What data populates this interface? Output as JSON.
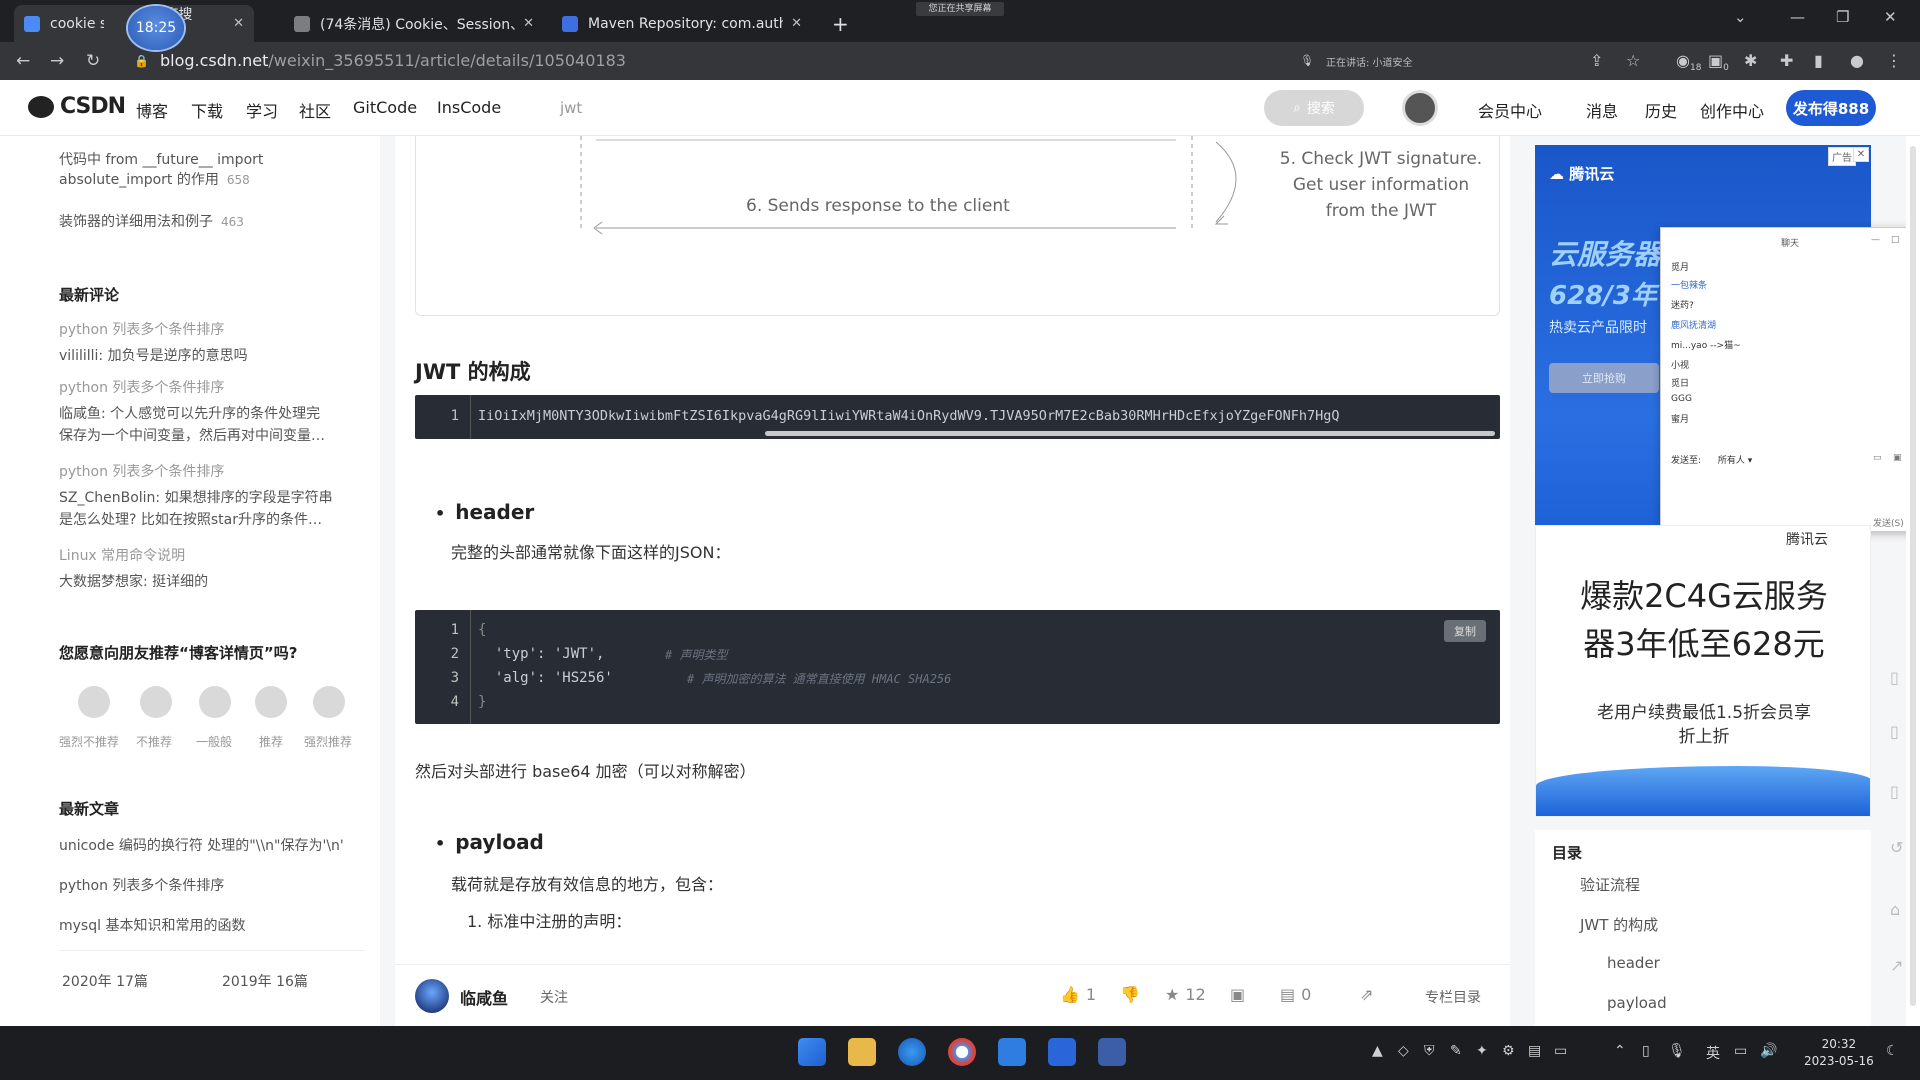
{
  "browser": {
    "tabs": [
      {
        "title": "cookie sessi",
        "fav_color": "#4c8bf5",
        "active": true
      },
      {
        "title": "(74条消息) Cookie、Session、",
        "fav_color": "#7a7d82",
        "active": false
      },
      {
        "title": "Maven Repository: com.auth(",
        "fav_color": "#3d6fe0",
        "active": false
      }
    ],
    "overlap_tab_text": "度搜索",
    "clock_badge": "18:25",
    "share_banner": "您正在共享屏幕",
    "url_host": "blog.csdn.net",
    "url_path": "/weixin_35695511/article/details/105040183",
    "meeting_text": "正在讲话: 小道安全",
    "ext_badges": {
      "profile_count": "18",
      "ext_count": "0"
    }
  },
  "csdn": {
    "logo": "CSDN",
    "nav": [
      "博客",
      "下载",
      "学习",
      "社区",
      "GitCode",
      "InsCode"
    ],
    "search_word": "jwt",
    "search_button": "搜索",
    "right_links": [
      "会员中心",
      "消息",
      "历史",
      "创作中心"
    ],
    "create_button": "发布得888"
  },
  "left": {
    "top_items": [
      {
        "line1": "代码中 from __future__ import",
        "line2": "absolute_import 的作用",
        "views": "658"
      },
      {
        "line1": "装饰器的详细用法和例子",
        "views": "463"
      }
    ],
    "latest_comments_title": "最新评论",
    "comments": [
      {
        "title": "python 列表多个条件排序",
        "text": "vilililli: 加负号是逆序的意思吗"
      },
      {
        "title": "python 列表多个条件排序",
        "text": "临咸鱼: 个人感觉可以先升序的条件处理完",
        "text2": "保存为一个中间变量，然后再对中间变量…"
      },
      {
        "title": "python 列表多个条件排序",
        "text": "SZ_ChenBolin: 如果想排序的字段是字符串",
        "text2": "是怎么处理? 比如在按照star升序的条件…"
      },
      {
        "title": "Linux 常用命令说明",
        "text": "大数据梦想家: 挺详细的"
      }
    ],
    "recommend_title": "您愿意向朋友推荐“博客详情页”吗?",
    "faces": [
      "强烈不推荐",
      "不推荐",
      "一般般",
      "推荐",
      "强烈推荐"
    ],
    "latest_articles_title": "最新文章",
    "articles": [
      "unicode 编码的换行符 处理的\"\\\\n\"保存为'\\n'",
      "python 列表多个条件排序",
      "mysql 基本知识和常用的函数"
    ],
    "archive": [
      {
        "year": "2020年",
        "count": "17篇"
      },
      {
        "year": "2019年",
        "count": "16篇"
      }
    ]
  },
  "article": {
    "diagram": {
      "step5": [
        "5. Check JWT signature.",
        "Get user information",
        "from the JWT"
      ],
      "step6": "6. Sends response to the client"
    },
    "h2": "JWT 的构成",
    "token_line_no": "1",
    "token": "IiOiIxMjM0NTY3ODkwIiwibmFtZSI6IkpvaG4gRG9lIiwiYWRtaW4iOnRydWV9.TJVA95OrM7E2cBab30RMHrHDcEfxjoYZgeFONFh7HgQ",
    "header_title": "header",
    "header_desc": "完整的头部通常就像下面这样的JSON：",
    "code_lines": [
      {
        "no": "1",
        "text": "{",
        "comment": ""
      },
      {
        "no": "2",
        "text": "  'typ': 'JWT',",
        "comment": "# 声明类型"
      },
      {
        "no": "3",
        "text": "  'alg': 'HS256'",
        "comment": "# 声明加密的算法 通常直接使用 HMAC SHA256"
      },
      {
        "no": "4",
        "text": "}",
        "comment": ""
      }
    ],
    "copy_label": "复制",
    "base64_text": "然后对头部进行 base64 加密（可以对称解密）",
    "payload_title": "payload",
    "payload_desc": "载荷就是存放有效信息的地方，包含：",
    "payload_list_1": "1. 标准中注册的声明："
  },
  "footer": {
    "author": "临咸鱼",
    "follow": "关注",
    "likes": "1",
    "stars": "12",
    "comments": "0",
    "column_toc": "专栏目录"
  },
  "ads": {
    "ad1_brand": "腾讯云",
    "ad1_big": "云服务器",
    "ad1_price": "628/3年",
    "ad1_tag": "热卖云产品限时",
    "ad1_btn": "立即抢购",
    "ad_label": "广告",
    "ad2_brand": "腾讯云",
    "ad2_headline_1": "爆款2C4G云服务",
    "ad2_headline_2": "器3年低至628元",
    "ad2_sub_1": "老用户续费最低1.5折会员享",
    "ad2_sub_2": "折上折"
  },
  "chat": {
    "title": "聊天",
    "messages": [
      {
        "text": "觅月",
        "blue": false
      },
      {
        "text": "一包辣条",
        "blue": true
      },
      {
        "text": "迷药?",
        "blue": false
      },
      {
        "text": "鹿风抚清湖",
        "blue": true
      },
      {
        "text": "mi...yao -->猫~",
        "blue": false
      },
      {
        "text": "小视",
        "blue": false
      },
      {
        "text": "觅日",
        "blue": false
      },
      {
        "text": "GGG",
        "blue": false
      },
      {
        "text": "蜜月",
        "blue": false
      }
    ],
    "send_to": "发送至:",
    "send_target": "所有人",
    "send_button": "发送(S)"
  },
  "toc": {
    "title": "目录",
    "items": [
      "验证流程",
      "JWT 的构成",
      "header",
      "payload"
    ]
  },
  "taskbar": {
    "time": "20:32",
    "date": "2023-05-16",
    "ime": "英"
  }
}
